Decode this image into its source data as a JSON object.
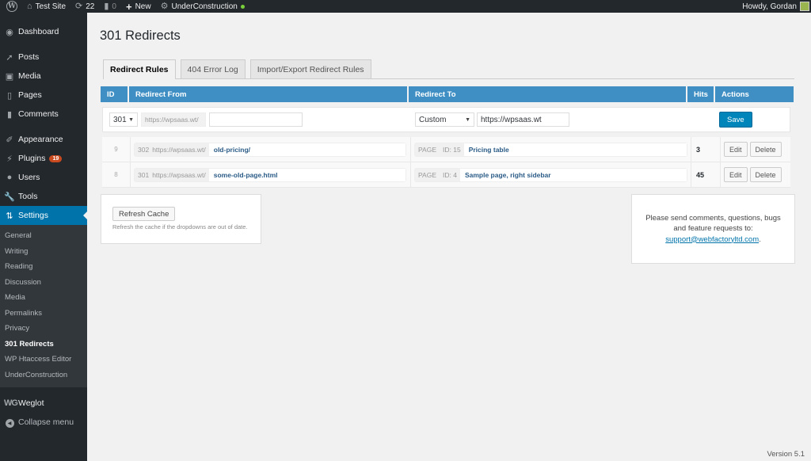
{
  "adminbar": {
    "site_name": "Test Site",
    "updates_count": "22",
    "comments_count": "0",
    "new_label": "New",
    "plugin_label": "UnderConstruction",
    "plugin_status_color": "#7ad03a",
    "greeting": "Howdy, Gordan"
  },
  "sidebar": {
    "items": [
      {
        "label": "Dashboard",
        "icon": "dashboard-icon"
      },
      {
        "label": "Posts",
        "icon": "pin-icon"
      },
      {
        "label": "Media",
        "icon": "media-icon"
      },
      {
        "label": "Pages",
        "icon": "pages-icon"
      },
      {
        "label": "Comments",
        "icon": "comment-icon"
      },
      {
        "label": "Appearance",
        "icon": "brush-icon"
      },
      {
        "label": "Plugins",
        "icon": "plug-icon",
        "badge": "19"
      },
      {
        "label": "Users",
        "icon": "user-icon"
      },
      {
        "label": "Tools",
        "icon": "wrench-icon"
      },
      {
        "label": "Settings",
        "icon": "settings-icon",
        "active": true
      }
    ],
    "submenu": [
      "General",
      "Writing",
      "Reading",
      "Discussion",
      "Media",
      "Permalinks",
      "Privacy",
      "301 Redirects",
      "WP Htaccess Editor",
      "UnderConstruction"
    ],
    "current_sub": "301 Redirects",
    "weglot_logo": "WG",
    "weglot": "Weglot",
    "collapse": "Collapse menu"
  },
  "page": {
    "title": "301 Redirects",
    "tabs": [
      "Redirect Rules",
      "404 Error Log",
      "Import/Export Redirect Rules"
    ],
    "active_tab": "Redirect Rules"
  },
  "table": {
    "headers": {
      "id": "ID",
      "from": "Redirect From",
      "to": "Redirect To",
      "hits": "Hits",
      "actions": "Actions"
    },
    "new_rule": {
      "status_code": "301",
      "from_prefix": "https://wpsaas.wt/",
      "from_value": "",
      "to_type": "Custom",
      "to_value": "https://wpsaas.wt",
      "save_label": "Save"
    },
    "rows": [
      {
        "id": "9",
        "code": "302",
        "prefix": "https://wpsaas.wt/",
        "from": "old-pricing/",
        "to_type": "PAGE",
        "to_id": "ID: 15",
        "to": "Pricing table",
        "hits": "3"
      },
      {
        "id": "8",
        "code": "301",
        "prefix": "https://wpsaas.wt/",
        "from": "some-old-page.html",
        "to_type": "PAGE",
        "to_id": "ID: 4",
        "to": "Sample page, right sidebar",
        "hits": "45"
      }
    ],
    "edit_label": "Edit",
    "delete_label": "Delete"
  },
  "cache": {
    "button": "Refresh Cache",
    "help": "Refresh the cache if the dropdowns are out of date."
  },
  "support": {
    "text": "Please send comments, questions, bugs and feature requests to:",
    "email": "support@webfactoryltd.com",
    "trail": "."
  },
  "footer": {
    "version": "Version 5.1"
  },
  "colors": {
    "accent": "#0073aa",
    "table_header": "#3f8fc4",
    "sidebar": "#23282d",
    "badge": "#ca4a1f"
  }
}
